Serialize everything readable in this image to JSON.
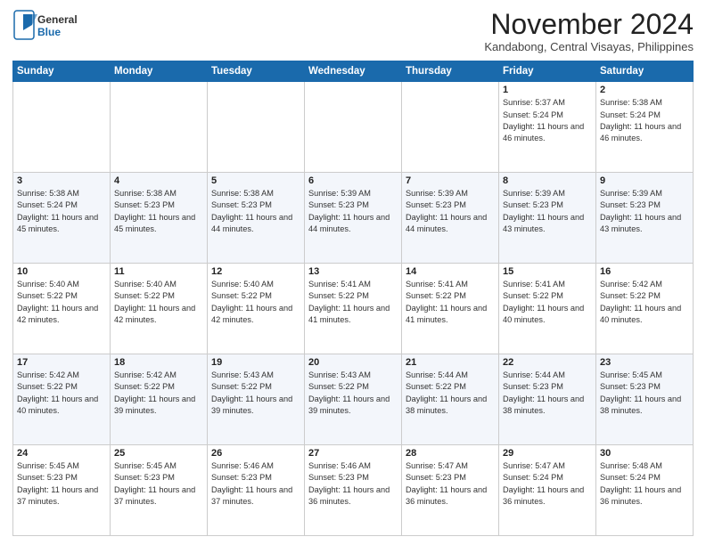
{
  "header": {
    "logo_general": "General",
    "logo_blue": "Blue",
    "month": "November 2024",
    "location": "Kandabong, Central Visayas, Philippines"
  },
  "days_of_week": [
    "Sunday",
    "Monday",
    "Tuesday",
    "Wednesday",
    "Thursday",
    "Friday",
    "Saturday"
  ],
  "weeks": [
    [
      {
        "day": "",
        "info": ""
      },
      {
        "day": "",
        "info": ""
      },
      {
        "day": "",
        "info": ""
      },
      {
        "day": "",
        "info": ""
      },
      {
        "day": "",
        "info": ""
      },
      {
        "day": "1",
        "info": "Sunrise: 5:37 AM\nSunset: 5:24 PM\nDaylight: 11 hours\nand 46 minutes."
      },
      {
        "day": "2",
        "info": "Sunrise: 5:38 AM\nSunset: 5:24 PM\nDaylight: 11 hours\nand 46 minutes."
      }
    ],
    [
      {
        "day": "3",
        "info": "Sunrise: 5:38 AM\nSunset: 5:24 PM\nDaylight: 11 hours\nand 45 minutes."
      },
      {
        "day": "4",
        "info": "Sunrise: 5:38 AM\nSunset: 5:23 PM\nDaylight: 11 hours\nand 45 minutes."
      },
      {
        "day": "5",
        "info": "Sunrise: 5:38 AM\nSunset: 5:23 PM\nDaylight: 11 hours\nand 44 minutes."
      },
      {
        "day": "6",
        "info": "Sunrise: 5:39 AM\nSunset: 5:23 PM\nDaylight: 11 hours\nand 44 minutes."
      },
      {
        "day": "7",
        "info": "Sunrise: 5:39 AM\nSunset: 5:23 PM\nDaylight: 11 hours\nand 44 minutes."
      },
      {
        "day": "8",
        "info": "Sunrise: 5:39 AM\nSunset: 5:23 PM\nDaylight: 11 hours\nand 43 minutes."
      },
      {
        "day": "9",
        "info": "Sunrise: 5:39 AM\nSunset: 5:23 PM\nDaylight: 11 hours\nand 43 minutes."
      }
    ],
    [
      {
        "day": "10",
        "info": "Sunrise: 5:40 AM\nSunset: 5:22 PM\nDaylight: 11 hours\nand 42 minutes."
      },
      {
        "day": "11",
        "info": "Sunrise: 5:40 AM\nSunset: 5:22 PM\nDaylight: 11 hours\nand 42 minutes."
      },
      {
        "day": "12",
        "info": "Sunrise: 5:40 AM\nSunset: 5:22 PM\nDaylight: 11 hours\nand 42 minutes."
      },
      {
        "day": "13",
        "info": "Sunrise: 5:41 AM\nSunset: 5:22 PM\nDaylight: 11 hours\nand 41 minutes."
      },
      {
        "day": "14",
        "info": "Sunrise: 5:41 AM\nSunset: 5:22 PM\nDaylight: 11 hours\nand 41 minutes."
      },
      {
        "day": "15",
        "info": "Sunrise: 5:41 AM\nSunset: 5:22 PM\nDaylight: 11 hours\nand 40 minutes."
      },
      {
        "day": "16",
        "info": "Sunrise: 5:42 AM\nSunset: 5:22 PM\nDaylight: 11 hours\nand 40 minutes."
      }
    ],
    [
      {
        "day": "17",
        "info": "Sunrise: 5:42 AM\nSunset: 5:22 PM\nDaylight: 11 hours\nand 40 minutes."
      },
      {
        "day": "18",
        "info": "Sunrise: 5:42 AM\nSunset: 5:22 PM\nDaylight: 11 hours\nand 39 minutes."
      },
      {
        "day": "19",
        "info": "Sunrise: 5:43 AM\nSunset: 5:22 PM\nDaylight: 11 hours\nand 39 minutes."
      },
      {
        "day": "20",
        "info": "Sunrise: 5:43 AM\nSunset: 5:22 PM\nDaylight: 11 hours\nand 39 minutes."
      },
      {
        "day": "21",
        "info": "Sunrise: 5:44 AM\nSunset: 5:22 PM\nDaylight: 11 hours\nand 38 minutes."
      },
      {
        "day": "22",
        "info": "Sunrise: 5:44 AM\nSunset: 5:23 PM\nDaylight: 11 hours\nand 38 minutes."
      },
      {
        "day": "23",
        "info": "Sunrise: 5:45 AM\nSunset: 5:23 PM\nDaylight: 11 hours\nand 38 minutes."
      }
    ],
    [
      {
        "day": "24",
        "info": "Sunrise: 5:45 AM\nSunset: 5:23 PM\nDaylight: 11 hours\nand 37 minutes."
      },
      {
        "day": "25",
        "info": "Sunrise: 5:45 AM\nSunset: 5:23 PM\nDaylight: 11 hours\nand 37 minutes."
      },
      {
        "day": "26",
        "info": "Sunrise: 5:46 AM\nSunset: 5:23 PM\nDaylight: 11 hours\nand 37 minutes."
      },
      {
        "day": "27",
        "info": "Sunrise: 5:46 AM\nSunset: 5:23 PM\nDaylight: 11 hours\nand 36 minutes."
      },
      {
        "day": "28",
        "info": "Sunrise: 5:47 AM\nSunset: 5:23 PM\nDaylight: 11 hours\nand 36 minutes."
      },
      {
        "day": "29",
        "info": "Sunrise: 5:47 AM\nSunset: 5:24 PM\nDaylight: 11 hours\nand 36 minutes."
      },
      {
        "day": "30",
        "info": "Sunrise: 5:48 AM\nSunset: 5:24 PM\nDaylight: 11 hours\nand 36 minutes."
      }
    ]
  ]
}
